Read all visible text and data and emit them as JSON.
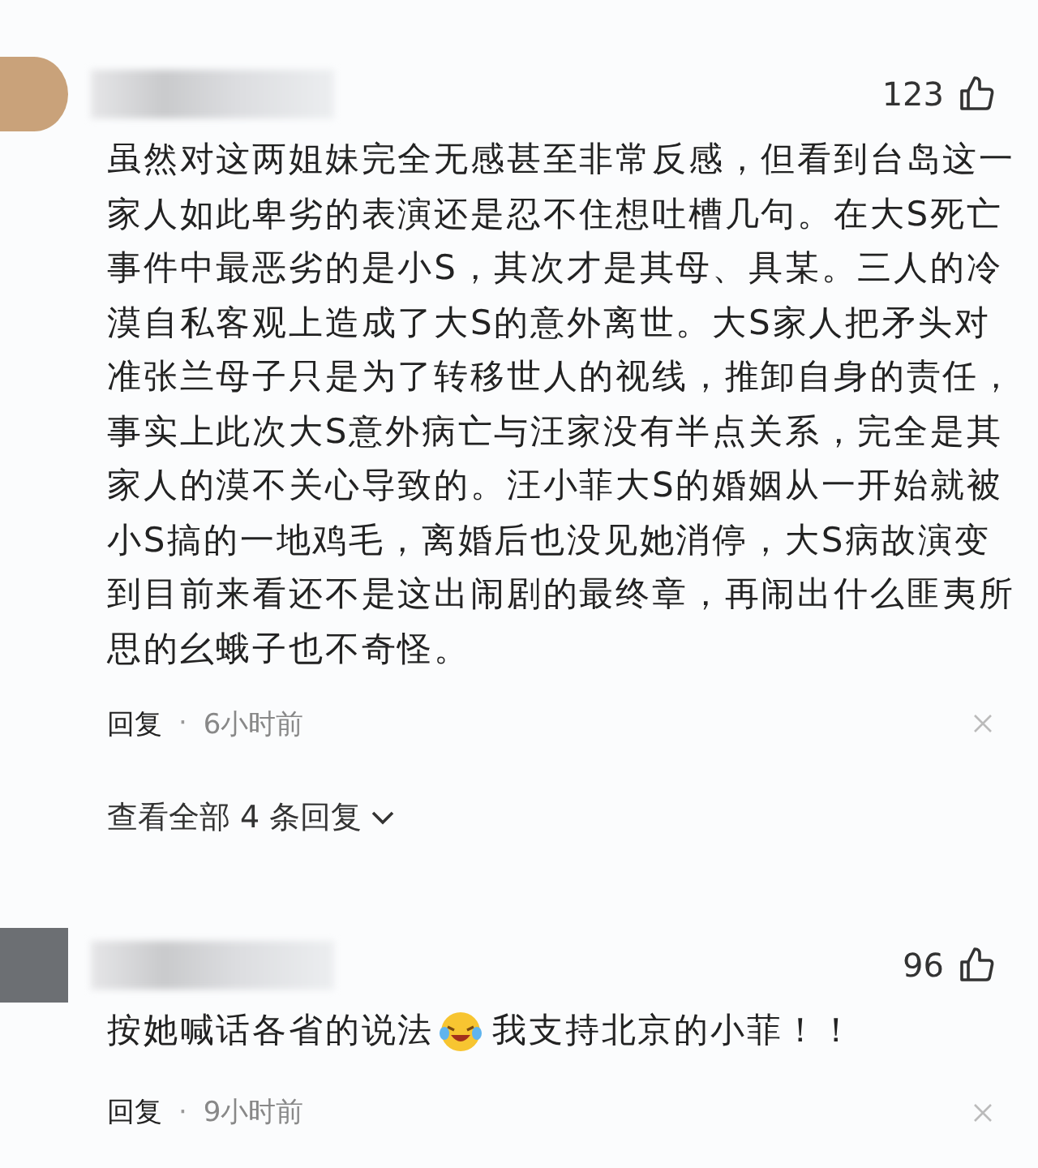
{
  "comments": [
    {
      "likes": "123",
      "text": "虽然对这两姐妹完全无感甚至非常反感，但看到台岛这一家人如此卑劣的表演还是忍不住想吐槽几句。在大S死亡事件中最恶劣的是小S，其次才是其母、具某。三人的冷漠自私客观上造成了大S的意外离世。大S家人把矛头对准张兰母子只是为了转移世人的视线，推卸自身的责任，事实上此次大S意外病亡与汪家没有半点关系，完全是其家人的漠不关心导致的。汪小菲大S的婚姻从一开始就被小S搞的一地鸡毛，离婚后也没见她消停，大S病故演变到目前来看还不是这出闹剧的最终章，再闹出什么匪夷所思的幺蛾子也不奇怪。",
      "reply": "回复",
      "dot": "·",
      "time": "6小时前",
      "view_replies": "查看全部 4 条回复"
    },
    {
      "likes": "96",
      "text": "按她喊话各省的说法",
      "text_after_emoji": "我支持北京的小菲！！",
      "reply": "回复",
      "dot": "·",
      "time": "9小时前"
    }
  ]
}
